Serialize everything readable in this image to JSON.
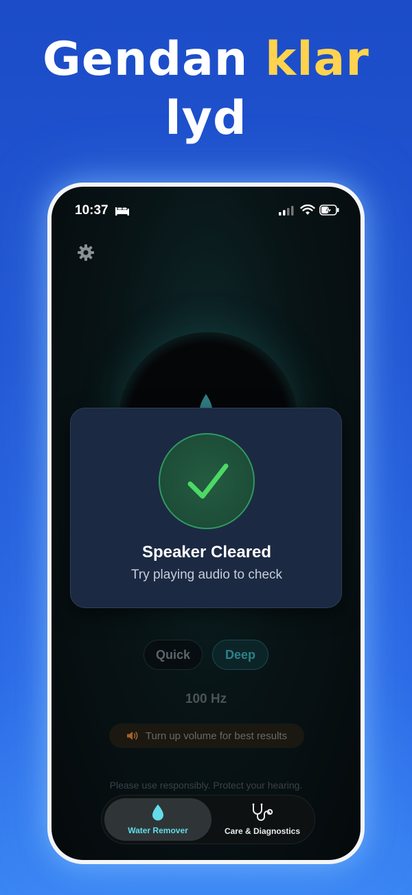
{
  "headline": {
    "part1": "Gendan ",
    "accent": "klar",
    "part2": "lyd",
    "accent_color": "#ffd34d"
  },
  "status_bar": {
    "time": "10:37",
    "icons": [
      "bed-icon",
      "signal-icon",
      "wifi-icon",
      "battery-charging-icon"
    ]
  },
  "settings": {
    "icon": "gear-icon"
  },
  "modal": {
    "icon": "checkmark-icon",
    "title": "Speaker Cleared",
    "subtitle": "Try playing audio to check",
    "accent_color": "#4cd964"
  },
  "modes": {
    "items": [
      {
        "label": "Quick",
        "selected": false
      },
      {
        "label": "Deep",
        "selected": true
      }
    ]
  },
  "frequency": "100 Hz",
  "volume_hint": {
    "icon": "speaker-icon",
    "text": "Turn up volume for best results"
  },
  "warning": "Please use responsibly. Protect your hearing.",
  "tabs": [
    {
      "label": "Water Remover",
      "icon": "water-drop-icon",
      "selected": true
    },
    {
      "label": "Care & Diagnostics",
      "icon": "stethoscope-icon",
      "selected": false
    }
  ]
}
